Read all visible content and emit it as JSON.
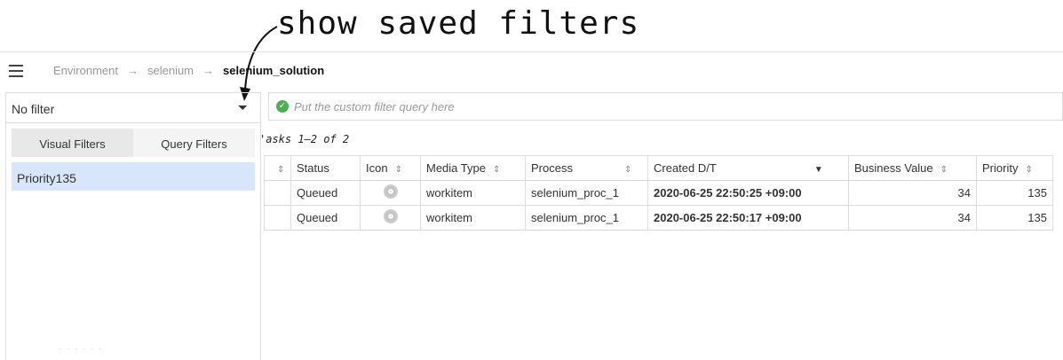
{
  "annotation": {
    "text": "show saved filters"
  },
  "breadcrumb": {
    "items": [
      "Environment",
      "selenium"
    ],
    "separator": "→",
    "current": "selenium_solution"
  },
  "left_panel": {
    "filter_select": "No filter",
    "tabs": [
      {
        "label": "Visual Filters",
        "active": true
      },
      {
        "label": "Query Filters",
        "active": false
      }
    ],
    "saved_filters": [
      "Priority135"
    ]
  },
  "query_bar": {
    "placeholder": "Put the custom filter query here",
    "status_color": "#4caf50"
  },
  "tasks_count": "'asks 1–2 of 2",
  "table": {
    "columns": [
      "",
      "Status",
      "Icon",
      "Media Type",
      "Process",
      "Created D/T",
      "Business Value",
      "Priority"
    ],
    "rows": [
      {
        "status": "Queued",
        "icon": "gear-icon",
        "media_type": "workitem",
        "process": "selenium_proc_1",
        "created": "2020-06-25 22:50:25 +09:00",
        "business_value": "34",
        "priority": "135"
      },
      {
        "status": "Queued",
        "icon": "gear-icon",
        "media_type": "workitem",
        "process": "selenium_proc_1",
        "created": "2020-06-25 22:50:17 +09:00",
        "business_value": "34",
        "priority": "135"
      }
    ]
  },
  "colors": {
    "selected_row": "#d7e6fa",
    "accent": "#4caf50"
  }
}
